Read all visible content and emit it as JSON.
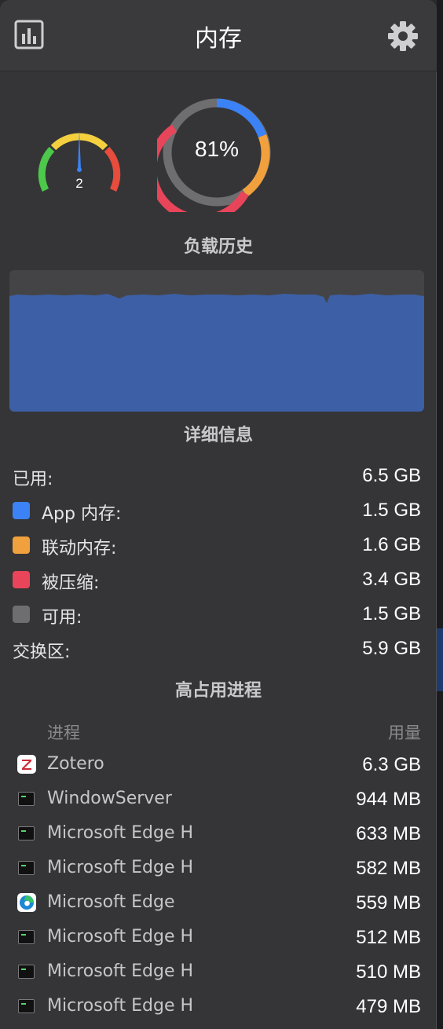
{
  "header": {
    "title": "内存",
    "chart_icon": "bar-chart-icon",
    "settings_icon": "gear-icon"
  },
  "gauges": {
    "load_value": "2",
    "memory_percent": "81%",
    "ring_colors": {
      "app": "#3b82f6",
      "wired": "#f0a03c",
      "compressed": "#e8455a",
      "free": "#6e6e70"
    }
  },
  "history": {
    "title": "负载历史",
    "fill_color": "#3d5fa6"
  },
  "details": {
    "title": "详细信息",
    "rows": [
      {
        "label": "已用:",
        "value": "6.5 GB"
      },
      {
        "label": "App 内存:",
        "value": "1.5 GB",
        "color": "#3b82f6"
      },
      {
        "label": "联动内存:",
        "value": "1.6 GB",
        "color": "#f0a03c"
      },
      {
        "label": "被压缩:",
        "value": "3.4 GB",
        "color": "#e8455a"
      },
      {
        "label": "可用:",
        "value": "1.5 GB",
        "color": "#6e6e70"
      },
      {
        "label": "交换区:",
        "value": "5.9 GB"
      }
    ]
  },
  "processes": {
    "title": "高占用进程",
    "col_process": "进程",
    "col_usage": "用量",
    "items": [
      {
        "name": "Zotero",
        "usage": "6.3 GB",
        "icon": "zotero-icon"
      },
      {
        "name": "WindowServer",
        "usage": "944 MB",
        "icon": "terminal-icon"
      },
      {
        "name": "Microsoft Edge H",
        "usage": "633 MB",
        "icon": "terminal-icon"
      },
      {
        "name": "Microsoft Edge H",
        "usage": "582 MB",
        "icon": "terminal-icon"
      },
      {
        "name": "Microsoft Edge",
        "usage": "559 MB",
        "icon": "edge-icon"
      },
      {
        "name": "Microsoft Edge H",
        "usage": "512 MB",
        "icon": "terminal-icon"
      },
      {
        "name": "Microsoft Edge H",
        "usage": "510 MB",
        "icon": "terminal-icon"
      },
      {
        "name": "Microsoft Edge H",
        "usage": "479 MB",
        "icon": "terminal-icon"
      }
    ]
  }
}
